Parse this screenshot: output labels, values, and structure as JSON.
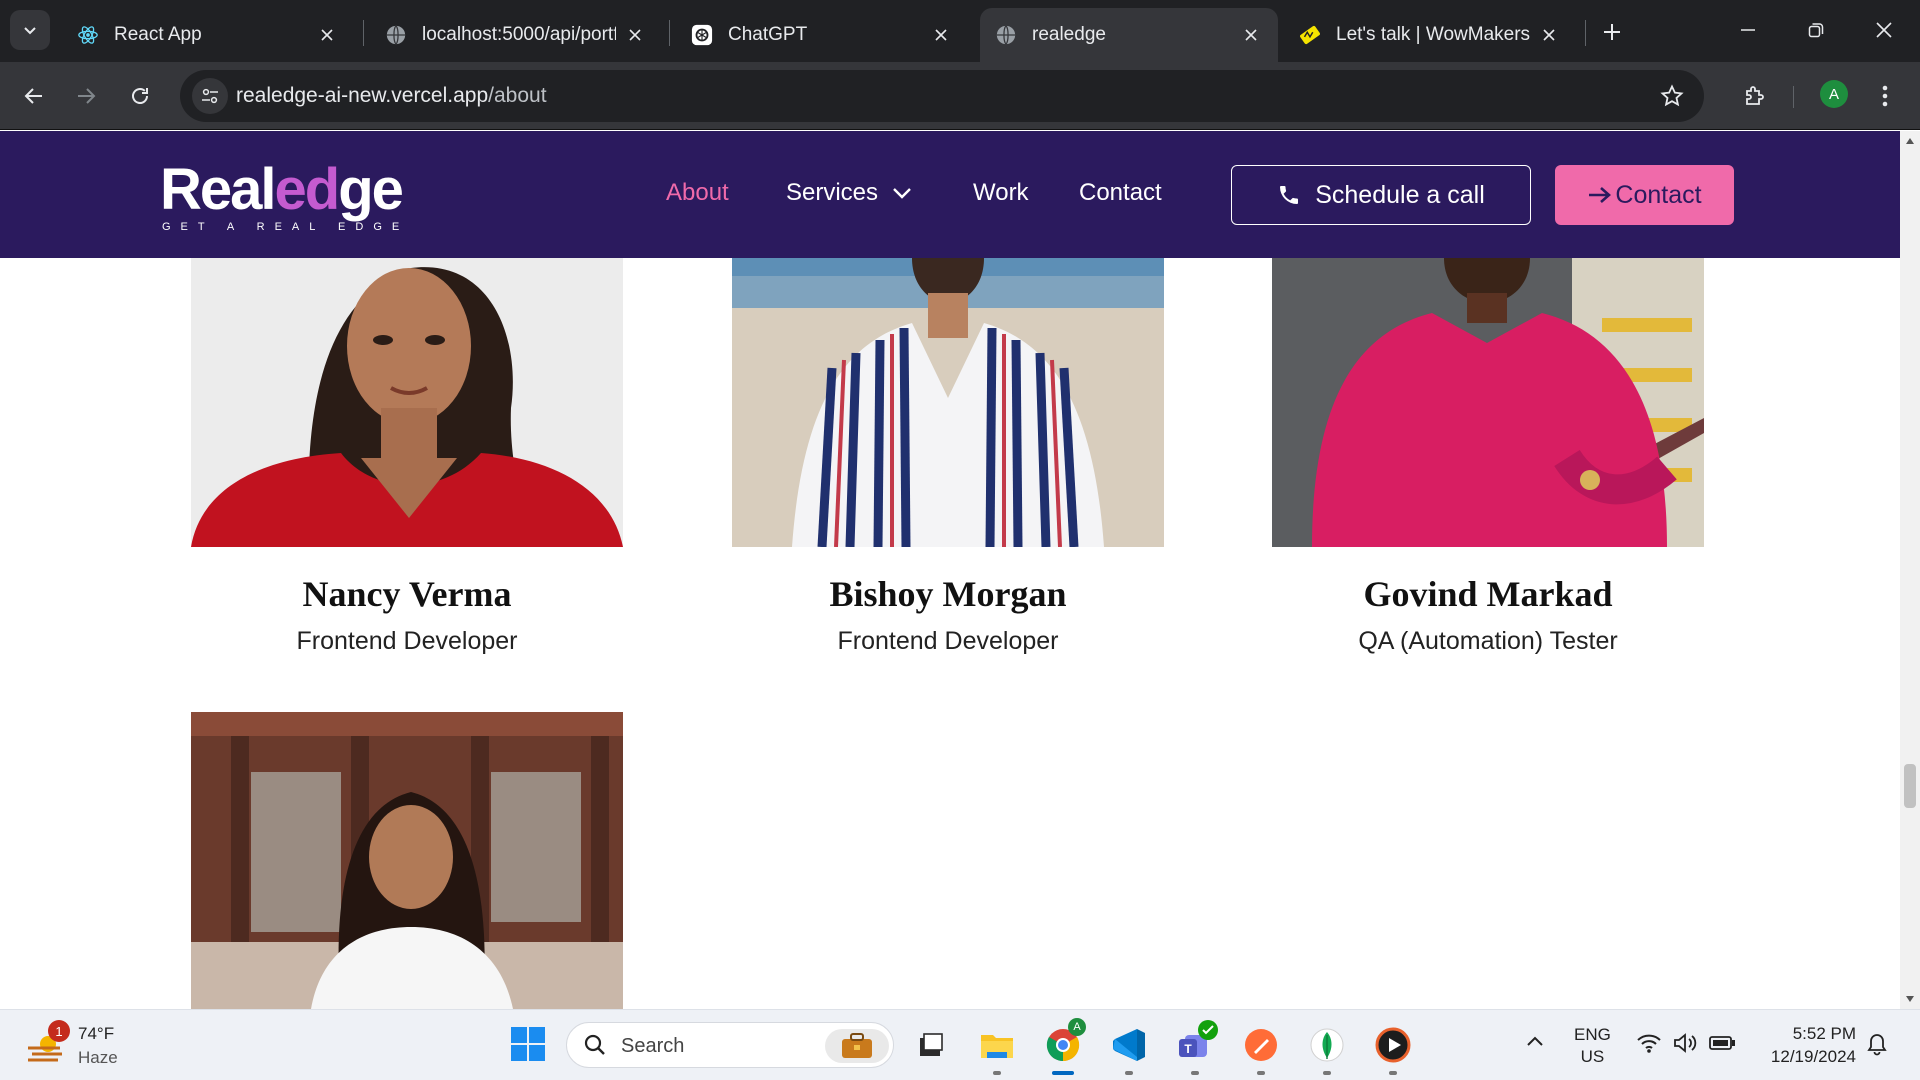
{
  "browser": {
    "tabs": [
      {
        "title": "React App",
        "favicon": "react-icon"
      },
      {
        "title": "localhost:5000/api/portfo",
        "favicon": "globe-icon"
      },
      {
        "title": "ChatGPT",
        "favicon": "chatgpt-icon"
      },
      {
        "title": "realedge",
        "favicon": "globe-icon",
        "active": true
      },
      {
        "title": "Let's talk | WowMakers",
        "favicon": "wowmakers-icon"
      }
    ],
    "url_host": "realedge-ai-new.vercel.app",
    "url_path": "/about",
    "profile_initial": "A"
  },
  "site": {
    "logo_word_start": "Real",
    "logo_word_accent": "ed",
    "logo_word_end": "ge",
    "logo_tagline": "GET A REAL EDGE",
    "nav": {
      "about": "About",
      "services": "Services",
      "work": "Work",
      "contact": "Contact"
    },
    "schedule_label": "Schedule a call",
    "contact_button_label": "Contact",
    "colors": {
      "header_bg": "#2b1a5e",
      "accent_pink": "#f06aaa"
    }
  },
  "team": [
    {
      "name": "Nancy Verma",
      "role": "Frontend Developer"
    },
    {
      "name": "Bishoy Morgan",
      "role": "Frontend Developer"
    },
    {
      "name": "Govind Markad",
      "role": "QA (Automation) Tester"
    }
  ],
  "taskbar": {
    "weather_badge": "1",
    "weather_temp": "74°F",
    "weather_condition": "Haze",
    "search_label": "Search",
    "teams_badge_icon": "check-icon",
    "chrome_badge": "A",
    "lang_primary": "ENG",
    "lang_secondary": "US",
    "time": "5:52 PM",
    "date": "12/19/2024"
  }
}
